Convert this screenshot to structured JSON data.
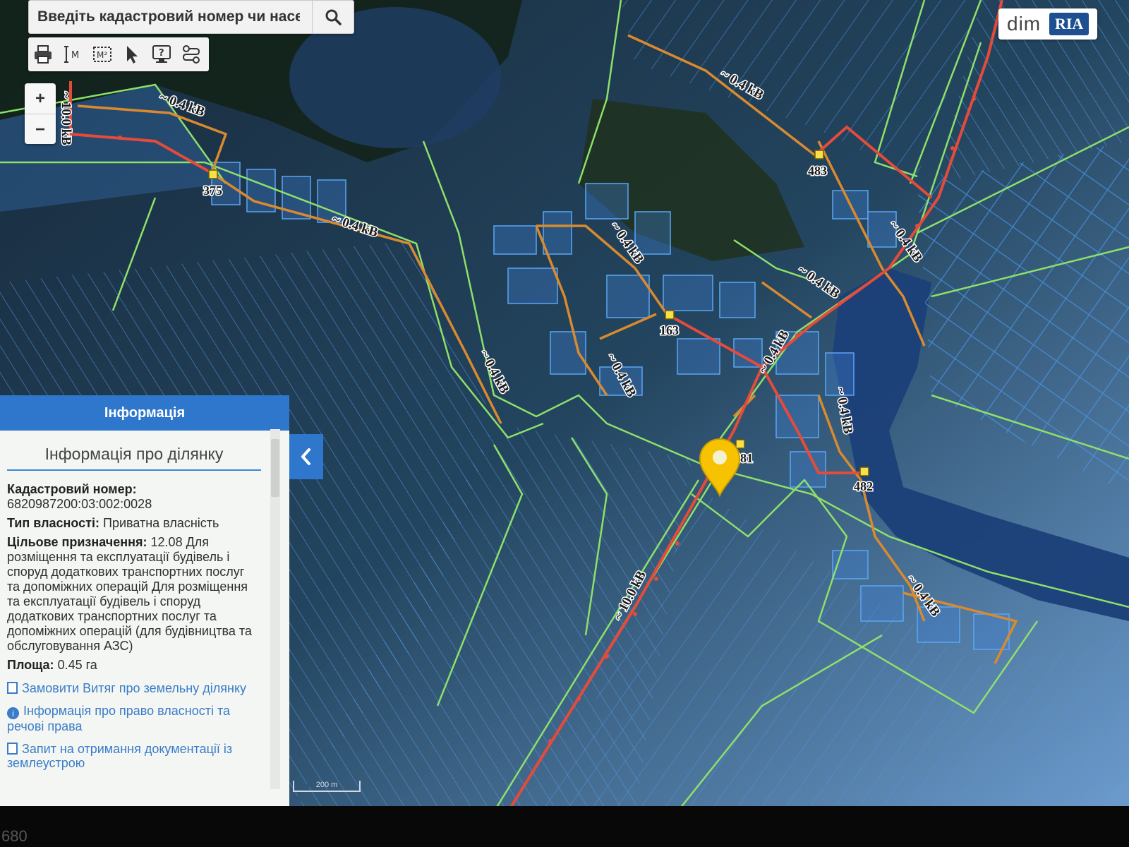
{
  "search": {
    "placeholder": "Введіть кадастровий номер чи населений",
    "search_icon": "search-icon"
  },
  "toolbar": {
    "tools": [
      "print-icon",
      "measure-line-icon",
      "measure-area-icon",
      "select-cursor-icon",
      "help-screen-icon",
      "route-icon"
    ],
    "measure_line_label": "M",
    "measure_area_label": "M²"
  },
  "zoom": {
    "in_label": "+",
    "out_label": "−"
  },
  "logo": {
    "dim": "dim",
    "ria": "RIA"
  },
  "map": {
    "substations": [
      {
        "label": "375"
      },
      {
        "label": "483"
      },
      {
        "label": "163"
      },
      {
        "label": "481"
      },
      {
        "label": "482"
      }
    ],
    "line_labels": [
      "~ 0.4 kB",
      "~ 0.4 kB",
      "~ 0.4 kB",
      "~ 0.4 kB",
      "~ 0.4 kB",
      "~ 0.4 kB",
      "~ 0.4 kB",
      "~ 0.4 kB",
      "~ 0.4 kB",
      "~ 0.4 kB",
      "~ 0.4 kB",
      "~ 10.0 kB",
      "~ 10.0 kB"
    ],
    "colors": {
      "parcel_stroke": "#3d8bea",
      "boundary": "#8ee06a",
      "line_10kv": "#e44b3b",
      "line_04kv": "#d98a2f",
      "marker": "#f7c300"
    }
  },
  "panel": {
    "header": "Інформація",
    "subtitle": "Інформація про ділянку",
    "cadastral_label": "Кадастровий номер:",
    "cadastral_value": "6820987200:03:002:0028",
    "ownership_label": "Тип власності:",
    "ownership_value": "Приватна власність",
    "purpose_label": "Цільове призначення:",
    "purpose_value": "12.08 Для розміщення та експлуатації будівель і споруд додаткових транспортних послуг та допоміжних операцій Для розміщення та експлуатації будівель і споруд додаткових транспортних послуг та допоміжних операцій (для будівництва та обслуговування АЗС)",
    "area_label": "Площа:",
    "area_value": "0.45 га",
    "links": [
      "Замовити Витяг про земельну ділянку",
      "Інформація про право власності та речові права",
      "Запит на отримання документації із землеустрою"
    ]
  },
  "scale": {
    "label": "200 m"
  },
  "bottom": {
    "number": "680"
  }
}
